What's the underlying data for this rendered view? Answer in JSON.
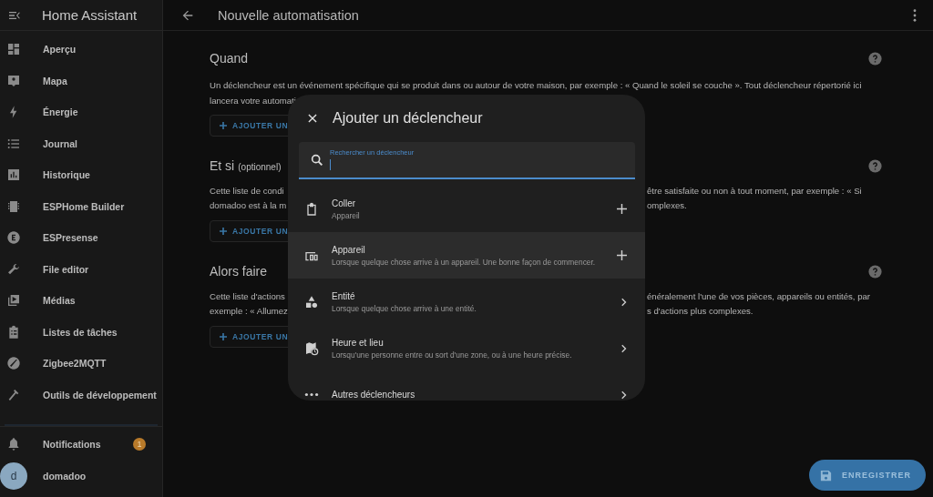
{
  "sidebar": {
    "title": "Home Assistant",
    "items": [
      {
        "label": "Aperçu"
      },
      {
        "label": "Mapa"
      },
      {
        "label": "Énergie"
      },
      {
        "label": "Journal"
      },
      {
        "label": "Historique"
      },
      {
        "label": "ESPHome Builder"
      },
      {
        "label": "ESPresense"
      },
      {
        "label": "File editor"
      },
      {
        "label": "Médias"
      },
      {
        "label": "Listes de tâches"
      },
      {
        "label": "Zigbee2MQTT"
      },
      {
        "label": "Outils de développement"
      }
    ],
    "notifications": {
      "label": "Notifications",
      "badge": "1"
    },
    "user": {
      "initial": "d",
      "name": "domadoo"
    }
  },
  "header": {
    "title": "Nouvelle automatisation"
  },
  "sections": [
    {
      "title": "Quand",
      "lines": [
        {
          "left": "Un déclencheur est un événement spécifique qui se produit dans ou autour de votre maison, par exemple : « Quand le soleil se couche ». Tout déclencheur répertorié ici"
        },
        {
          "left": "lancera votre automati"
        }
      ],
      "button": "AJOUTER UN"
    },
    {
      "title": "Et si",
      "note": "(optionnel)",
      "lines": [
        {
          "left": "Cette liste de condi",
          "right": "être satisfaite ou non à tout moment, par exemple : « Si"
        },
        {
          "left": "domadoo est à la m",
          "right": "omplexes."
        }
      ],
      "button": "AJOUTER UN"
    },
    {
      "title": "Alors faire",
      "lines": [
        {
          "left": "Cette liste d'actions",
          "right": "énéralement l'une de vos pièces, appareils ou entités, par"
        },
        {
          "left": "exemple : « Allumez",
          "right": "s d'actions plus complexes."
        }
      ],
      "button": "AJOUTER UN"
    }
  ],
  "dialog": {
    "title": "Ajouter un déclencheur",
    "search": {
      "label": "Rechercher un déclencheur"
    },
    "items": [
      {
        "title": "Coller",
        "subtitle": "Appareil",
        "kind": "add",
        "selected": false
      },
      {
        "title": "Appareil",
        "subtitle": "Lorsque quelque chose arrive à un appareil. Une bonne façon de commencer.",
        "kind": "add",
        "selected": true
      },
      {
        "title": "Entité",
        "subtitle": "Lorsque quelque chose arrive à une entité.",
        "kind": "group",
        "selected": false
      },
      {
        "title": "Heure et lieu",
        "subtitle": "Lorsqu'une personne entre ou sort d'une zone, ou à une heure précise.",
        "kind": "group",
        "selected": false
      },
      {
        "title": "Autres déclencheurs",
        "kind": "group",
        "selected": false
      }
    ]
  },
  "save_button": "ENREGISTRER"
}
